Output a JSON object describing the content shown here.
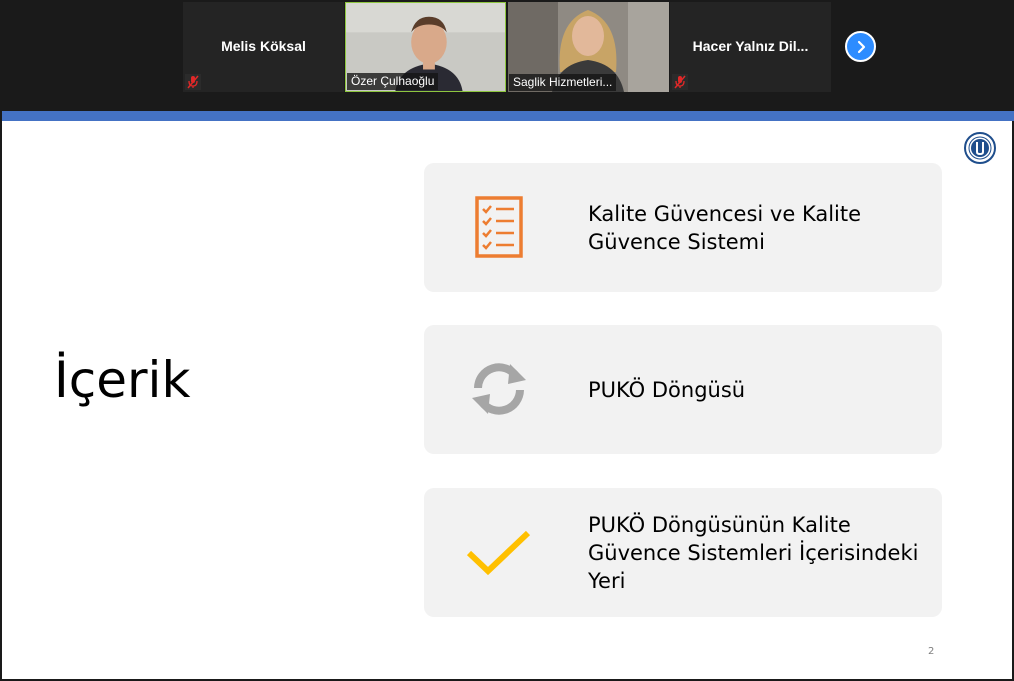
{
  "participants": [
    {
      "name": "Melis Köksal",
      "video": false,
      "muted": true
    },
    {
      "name": "Özer Çulhaoğlu",
      "video": true,
      "muted": false,
      "active_speaker": true
    },
    {
      "name": "Saglik Hizmetleri...",
      "video": true,
      "muted": false
    },
    {
      "name": "Hacer  Yalnız Dil...",
      "video": false,
      "muted": true
    }
  ],
  "strip": {
    "next_icon": "chevron-right-icon",
    "mic_muted_icon": "mic-muted-icon"
  },
  "slide": {
    "title": "İçerik",
    "page_number": "2",
    "items": [
      {
        "text": "Kalite Güvencesi ve Kalite Güvence Sistemi",
        "icon": "checklist-icon",
        "icon_color": "#ed7d31"
      },
      {
        "text": "PUKÖ Döngüsü",
        "icon": "refresh-cycle-icon",
        "icon_color": "#a6a6a6"
      },
      {
        "text": "PUKÖ Döngüsünün Kalite Güvence Sistemleri İçerisindeki Yeri",
        "icon": "checkmark-icon",
        "icon_color": "#ffc000"
      }
    ]
  },
  "colors": {
    "accent_bar": "#4472c4",
    "active_speaker_border": "#8ec63f",
    "next_button": "#2d8cff",
    "card_bg": "#f2f2f2"
  }
}
